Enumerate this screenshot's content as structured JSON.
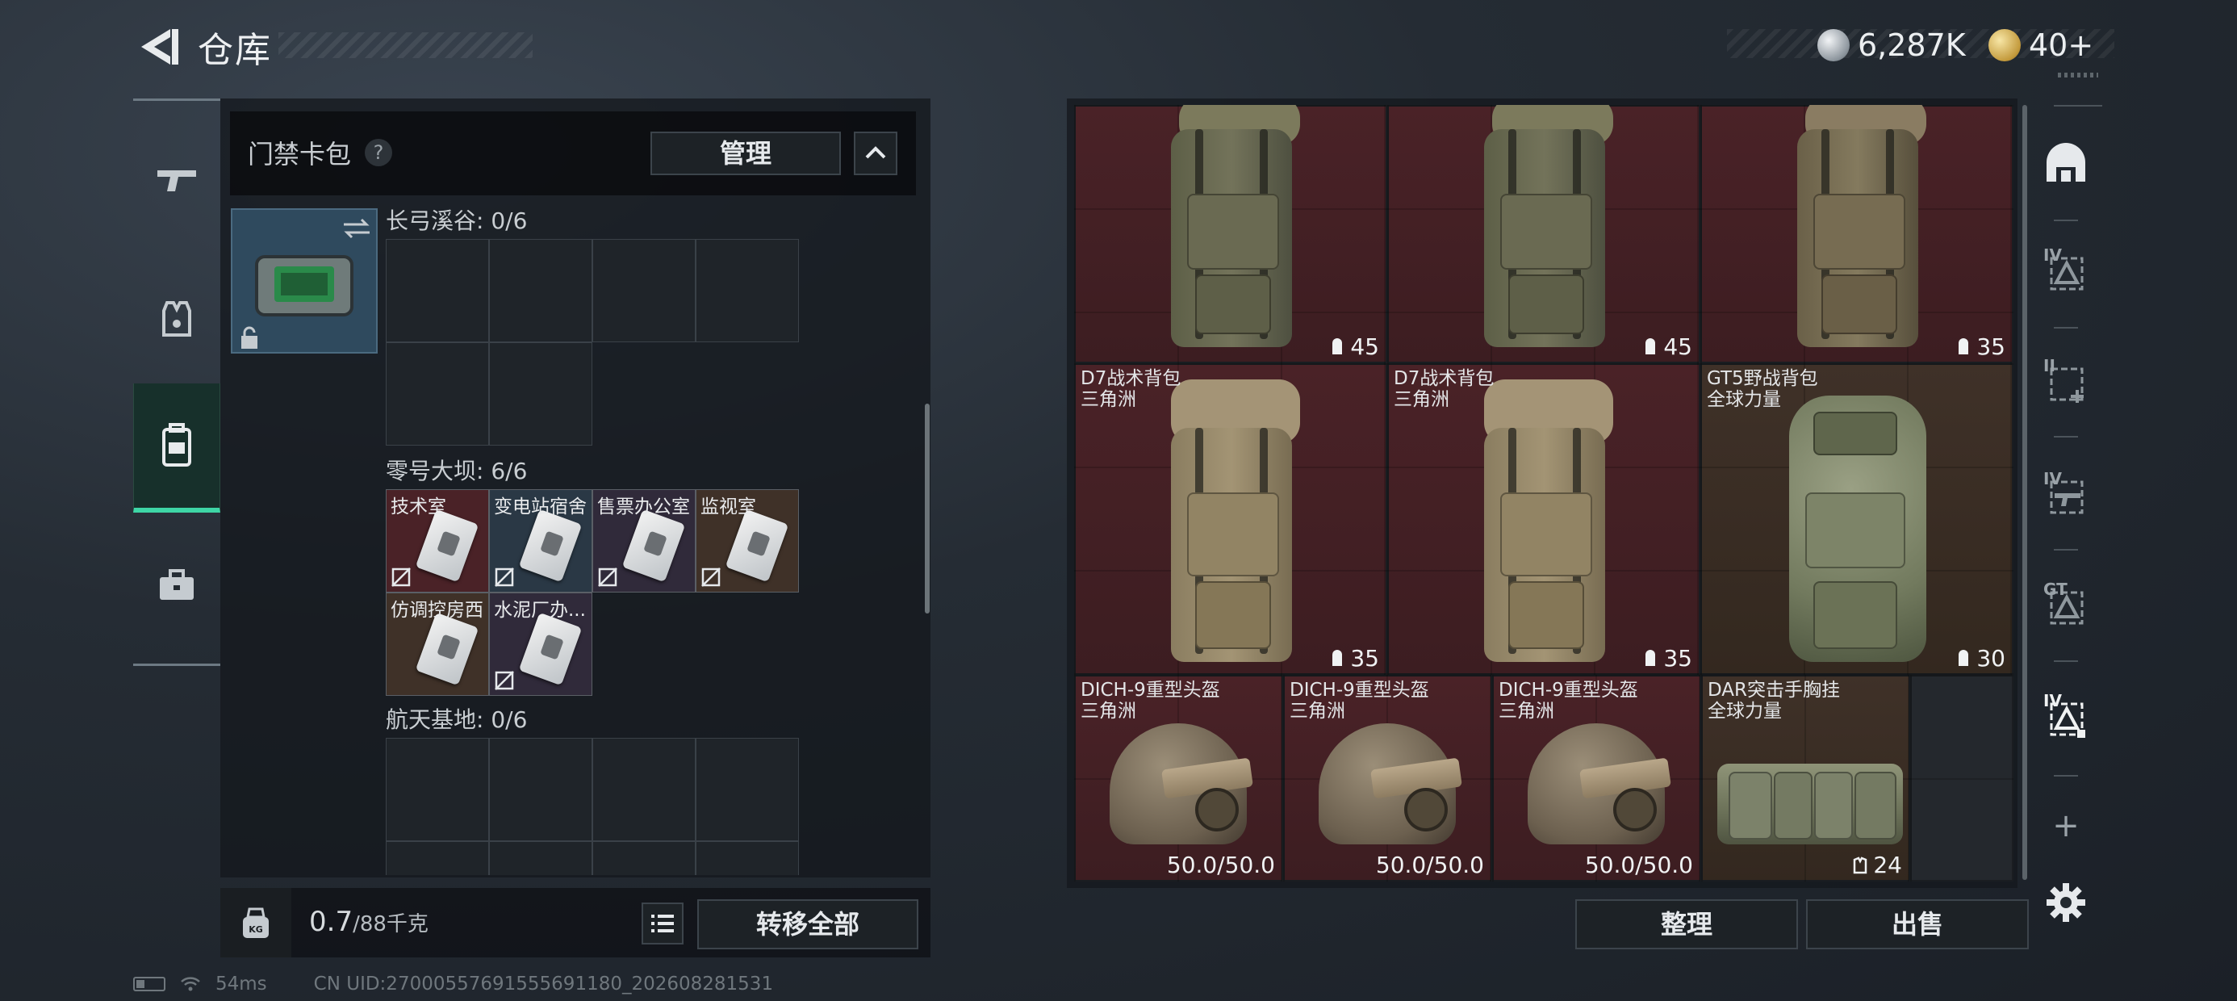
{
  "header": {
    "title": "仓库",
    "currency": [
      {
        "icon": "silver-coin-icon",
        "amount": "6,287K"
      },
      {
        "icon": "gold-coin-icon",
        "amount": "40+"
      }
    ]
  },
  "left_nav": {
    "items": [
      {
        "icon": "gun-icon",
        "active": false
      },
      {
        "icon": "vest-icon",
        "active": false
      },
      {
        "icon": "backpack-icon",
        "active": true
      },
      {
        "icon": "briefcase-icon",
        "active": false
      }
    ]
  },
  "keycard_panel": {
    "title": "门禁卡包",
    "help": "?",
    "manage_label": "管理",
    "sections": [
      {
        "label": "长弓溪谷: 0/6"
      },
      {
        "label": "零号大坝: 6/6",
        "cards": [
          "技术室",
          "变电站宿舍",
          "售票办公室",
          "监视室",
          "仿调控房西",
          "水泥厂办..."
        ]
      },
      {
        "label": "航天基地: 0/6"
      }
    ]
  },
  "bottom_left": {
    "kg_icon_label": "KG",
    "weight_value": "0.7",
    "weight_capacity": "/88千克",
    "transfer_label": "转移全部"
  },
  "inventory": {
    "rows": [
      [
        {
          "name": "",
          "sub": "",
          "value": "45",
          "value_icon": "durability-icon"
        },
        {
          "name": "",
          "sub": "",
          "value": "45",
          "value_icon": "durability-icon"
        },
        {
          "name": "",
          "sub": "",
          "value": "35",
          "value_icon": "durability-icon"
        }
      ],
      [
        {
          "name": "D7战术背包",
          "sub": "三角洲",
          "value": "35",
          "value_icon": "durability-icon"
        },
        {
          "name": "D7战术背包",
          "sub": "三角洲",
          "value": "35",
          "value_icon": "durability-icon"
        },
        {
          "name": "GT5野战背包",
          "sub": "全球力量",
          "value": "30",
          "value_icon": "durability-icon"
        }
      ],
      [
        {
          "name": "DICH-9重型头盔",
          "sub": "三角洲",
          "value": "50.0/50.0"
        },
        {
          "name": "DICH-9重型头盔",
          "sub": "三角洲",
          "value": "50.0/50.0"
        },
        {
          "name": "DICH-9重型头盔",
          "sub": "三角洲",
          "value": "50.0/50.0"
        },
        {
          "name": "DAR突击手胸挂",
          "sub": "全球力量",
          "value": "24",
          "value_icon": "chest-rig-icon"
        }
      ]
    ],
    "colors": {
      "rare_red": "#4a2227",
      "brown": "#3f3128"
    }
  },
  "right_rail": {
    "tier_labels": [
      "IV",
      "II",
      "IV",
      "GT",
      "IV"
    ],
    "add_label": "+"
  },
  "bottom_right": {
    "sort_label": "整理",
    "sell_label": "出售"
  },
  "status_bar": {
    "ping": "54ms",
    "uid": "CN UID:27000557691555691180_202608281531"
  }
}
